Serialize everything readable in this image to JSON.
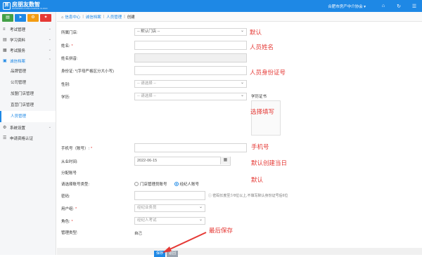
{
  "header": {
    "logo_mark": "房",
    "logo_title": "房朋友数智",
    "logo_sub": "FANGPENG INTELLIGENCE CLOUD",
    "user": "合肥市房产中介协会 ▾",
    "home_icon": "home-icon",
    "refresh_icon": "refresh-icon",
    "accent": "#1e88e5"
  },
  "sidebar": {
    "quick_buttons": [
      {
        "icon": "▤",
        "color": "#43a047"
      },
      {
        "icon": "➤",
        "color": "#1e88e5"
      },
      {
        "icon": "⚙",
        "color": "#f39c12"
      },
      {
        "icon": "✦",
        "color": "#e53935"
      }
    ],
    "menu": [
      {
        "label": "考试管理",
        "icon": "≡"
      },
      {
        "label": "学习资料",
        "icon": "▤"
      },
      {
        "label": "考试服务",
        "icon": "▦"
      },
      {
        "label": "诚信档案",
        "icon": "▣"
      }
    ],
    "sub": [
      "品牌管理",
      "公司管理",
      "加盟门店管理",
      "直营门店管理",
      "人员管理"
    ],
    "menu2": [
      {
        "label": "系统设置",
        "icon": "⚙"
      },
      {
        "label": "申请资格认证",
        "icon": "☰"
      }
    ]
  },
  "tabs": [
    "信息中心",
    "诚信档案",
    "人员管理",
    "创建"
  ],
  "form": {
    "store_label": "所属门店:",
    "store_value": "-- 默认门店 --",
    "name_label": "姓名:",
    "pinyin_label": "姓名拼音:",
    "idcard_label": "身份证: *(字母严格区分大小写)",
    "gender_label": "性别:",
    "gender_ph": "-- 请选择 --",
    "edu_label": "学历:",
    "edu_ph": "-- 请选择 --",
    "cert_label": "学历证书",
    "phone_label": "手机号（账号）:",
    "workdate_label": "从业时间:",
    "workdate_value": "2022-06-15",
    "account_section": "分配账号",
    "acct_type_label": "请选择账号类型:",
    "acct_options": [
      "门店管理员账号",
      "经纪人账号"
    ],
    "password_label": "密码:",
    "password_hint": "密码长度至少8位以上,不填写默认身份证号后6位",
    "usergroup_label": "用户组:",
    "usergroup_ph": "经纪业务员",
    "role_label": "角色:",
    "role_ph": "经纪人考试",
    "mgmt_label": "管理类型:",
    "mgmt_value": "自己"
  },
  "annotations": {
    "default": "默认",
    "person_name": "人员姓名",
    "person_id": "人员身份证号",
    "select_fill": "选择填写",
    "phone": "手机号",
    "default_date": "默认创建当日",
    "default2": "默认",
    "save_last": "最后保存",
    "color": "#e53935"
  },
  "buttons": {
    "save": "保存",
    "back": "返回"
  }
}
